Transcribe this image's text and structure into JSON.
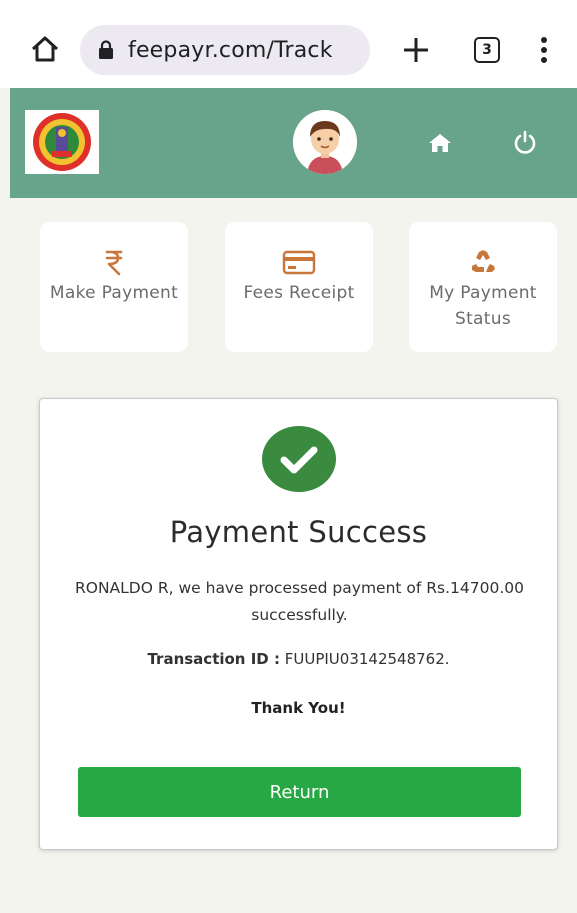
{
  "browser": {
    "url": "feepayr.com/Track",
    "tab_count": "3"
  },
  "tiles": [
    {
      "label": "Make Payment",
      "icon": "rupee-icon"
    },
    {
      "label": "Fees Receipt",
      "icon": "credit-card-icon"
    },
    {
      "label": "My Payment Status",
      "icon": "recycle-icon"
    }
  ],
  "success": {
    "title": "Payment Success",
    "message": "RONALDO R, we have processed payment of Rs.14700.00 successfully.",
    "txn_label": "Transaction ID :",
    "txn_value": "FUUPIU03142548762.",
    "thanks": "Thank You!",
    "return_label": "Return"
  },
  "colors": {
    "header": "#68a38c",
    "accent_icon": "#c8773a",
    "success_green": "#3a8a3f",
    "button_green": "#28a745"
  }
}
